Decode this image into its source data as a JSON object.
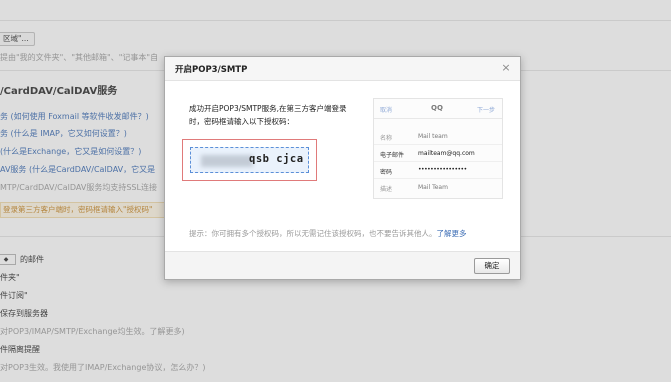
{
  "background": {
    "region_button": "区域\"...",
    "top_hint": "提由\"我的文件夹\"、\"其他邮箱\"、\"记事本\"自",
    "section_title": "/CardDAV/CalDAV服务",
    "lines": [
      "务 (如何使用 Foxmail 等软件收发邮件？)",
      "务 (什么是 IMAP，它又如何设置？)",
      "(什么是Exchange，它又是如何设置？)",
      "AV服务 (什么是CardDAV/CalDAV，它又是",
      "MTP/CardDAV/CalDAV服务均支持SSL连接"
    ],
    "notice": "登录第三方客户端时，密码框请输入\"授权码\"",
    "select_value": "◆",
    "lower_lines": [
      "的邮件",
      "件夹\"",
      "件订阅\"",
      "保存到服务器",
      "对POP3/IMAP/SMTP/Exchange均生效。了解更多)",
      "件隔离提醒",
      "对POP3生效。我使用了IMAP/Exchange协议，怎么办？)"
    ]
  },
  "dialog": {
    "title": "开启POP3/SMTP",
    "close": "×",
    "description": "成功开启POP3/SMTP服务,在第三方客户端登录时，密码框请输入以下授权码：",
    "auth_code_visible": "qsb cjca",
    "mock": {
      "cancel": "取消",
      "brand": "QQ",
      "next": "下一步",
      "rows": [
        {
          "key": "名称",
          "value": "Mail team"
        },
        {
          "key": "电子邮件",
          "value": "mailteam@qq.com"
        },
        {
          "key": "密码",
          "value": "••••••••••••••••"
        },
        {
          "key": "描述",
          "value": "Mail Team"
        }
      ]
    },
    "hint": "提示：你可拥有多个授权码，所以无需记住该授权码，也不要告诉其他人。",
    "learn_more": "了解更多",
    "ok": "确定"
  }
}
